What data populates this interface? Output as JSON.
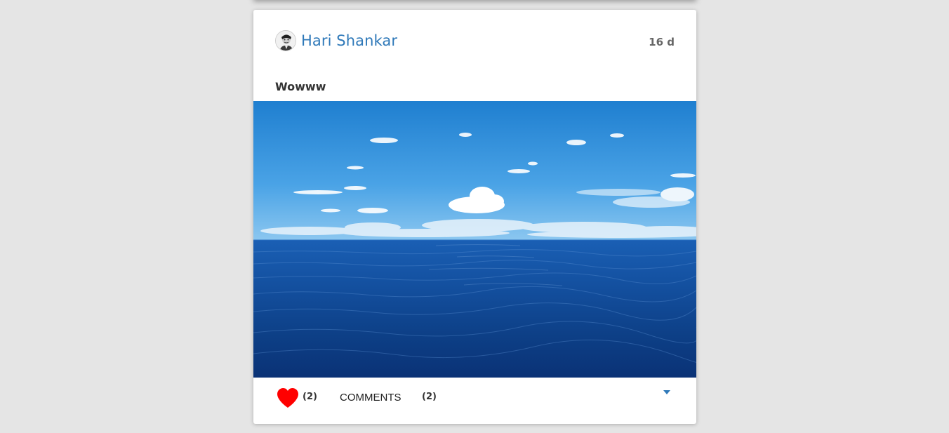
{
  "post": {
    "author": "Hari Shankar",
    "time": "16 d",
    "caption": "Wowww",
    "likes": "(2)",
    "comments_label": "COMMENTS",
    "comments_count": "(2)"
  },
  "colors": {
    "author": "#2f79b9",
    "like": "#ff0000",
    "dropdown": "#2f79b9",
    "background": "#e5e5e5"
  },
  "icons": {
    "like": "heart-icon",
    "dropdown": "caret-down-icon"
  }
}
